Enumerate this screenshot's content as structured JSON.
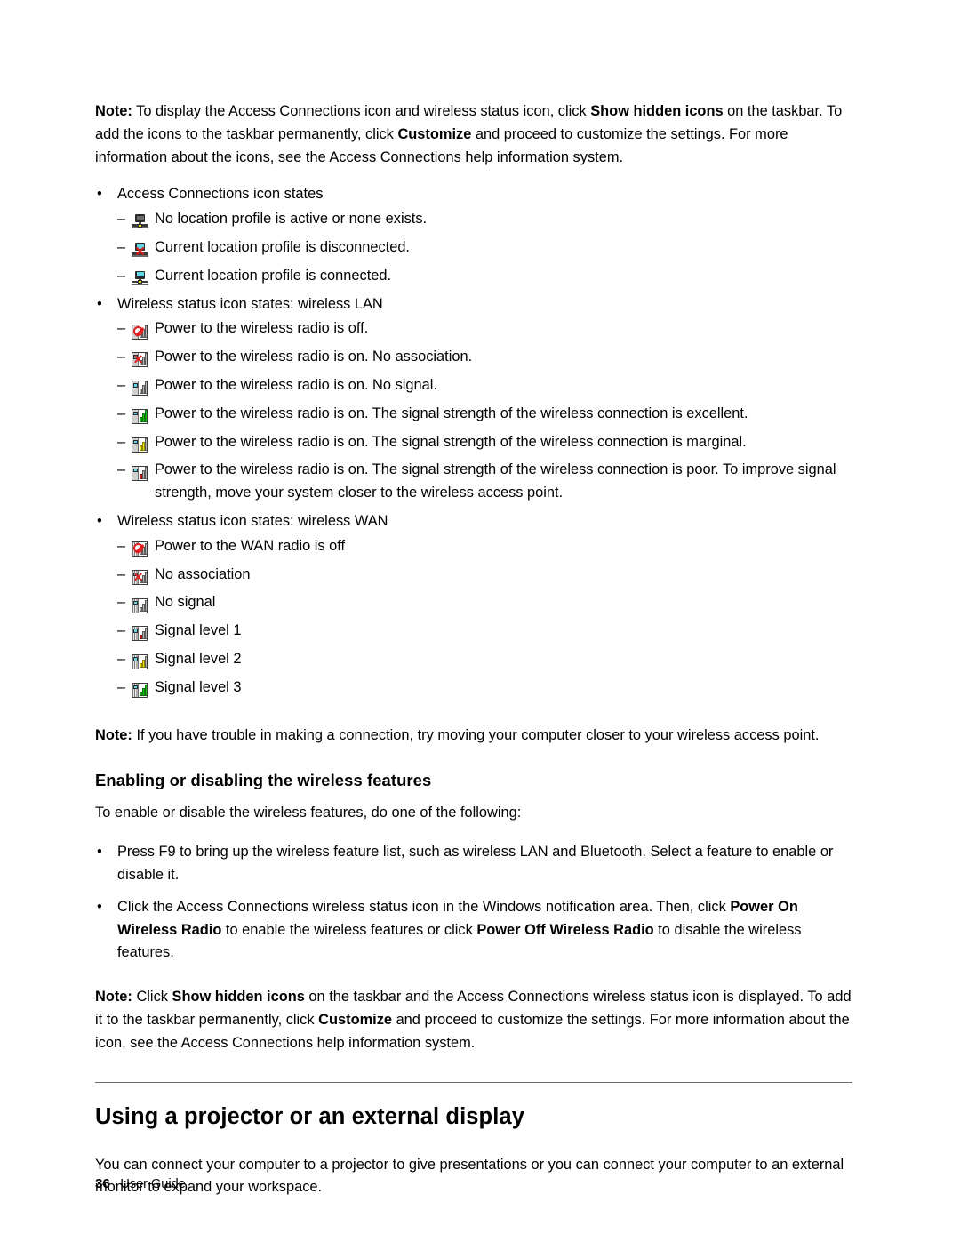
{
  "note_top": {
    "label": "Note:",
    "text_1": " To display the Access Connections icon and wireless status icon, click ",
    "bold_1": "Show hidden icons",
    "text_2": " on the taskbar. To add the icons to the taskbar permanently, click ",
    "bold_2": "Customize",
    "text_3": " and proceed to customize the settings. For more information about the icons, see the Access Connections help information system."
  },
  "access_connections": {
    "heading": "Access Connections icon states",
    "items": [
      {
        "icon": "computer-inactive-icon",
        "text": "No location profile is active or none exists."
      },
      {
        "icon": "computer-disconnected-icon",
        "text": "Current location profile is disconnected."
      },
      {
        "icon": "computer-connected-icon",
        "text": "Current location profile is connected."
      }
    ]
  },
  "wireless_lan": {
    "heading": "Wireless status icon states:  wireless LAN",
    "items": [
      {
        "icon": "wlan-radio-off-icon",
        "text": "Power to the wireless radio is off."
      },
      {
        "icon": "wlan-no-association-icon",
        "text": "Power to the wireless radio is on.  No association."
      },
      {
        "icon": "wlan-no-signal-icon",
        "text": "Power to the wireless radio is on.  No signal."
      },
      {
        "icon": "wlan-signal-excellent-icon",
        "text": "Power to the wireless radio is on. The signal strength of the wireless connection is excellent."
      },
      {
        "icon": "wlan-signal-marginal-icon",
        "text": "Power to the wireless radio is on. The signal strength of the wireless connection is marginal."
      },
      {
        "icon": "wlan-signal-poor-icon",
        "text": "Power to the wireless radio is on. The signal strength of the wireless connection is poor. To improve signal strength, move your system closer to the wireless access point."
      }
    ]
  },
  "wireless_wan": {
    "heading": "Wireless status icon states:  wireless WAN",
    "items": [
      {
        "icon": "wwan-radio-off-icon",
        "text": "Power to the WAN radio is off"
      },
      {
        "icon": "wwan-no-association-icon",
        "text": "No association"
      },
      {
        "icon": "wwan-no-signal-icon",
        "text": "No signal"
      },
      {
        "icon": "wwan-signal-level-1-icon",
        "text": "Signal level 1"
      },
      {
        "icon": "wwan-signal-level-2-icon",
        "text": "Signal level 2"
      },
      {
        "icon": "wwan-signal-level-3-icon",
        "text": "Signal level 3"
      }
    ]
  },
  "note_connection": {
    "label": "Note:",
    "text_1": " If you have trouble in making a connection, try moving your computer closer to your wireless access point."
  },
  "enabling_section": {
    "heading": "Enabling or disabling the wireless features",
    "intro": "To enable or disable the wireless features, do one of the following:",
    "bullet_1": "Press F9 to bring up the wireless feature list, such as wireless LAN and Bluetooth.  Select a feature to enable or disable it.",
    "bullet_2": {
      "text_1": "Click the Access Connections wireless status icon in the Windows notification area. Then, click ",
      "bold_1": "Power On Wireless Radio",
      "text_2": " to enable the wireless features or click ",
      "bold_2": "Power Off Wireless Radio",
      "text_3": " to disable the wireless features."
    }
  },
  "note_bottom": {
    "label": "Note:",
    "text_1": " Click ",
    "bold_1": "Show hidden icons",
    "text_2": " on the taskbar and the Access Connections wireless status icon is displayed. To add it to the taskbar permanently, click ",
    "bold_2": "Customize",
    "text_3": " and proceed to customize the settings. For more information about the icon, see the Access Connections help information system."
  },
  "projector_section": {
    "heading": "Using a projector or an external display",
    "paragraph": "You can connect your computer to a projector to give presentations or you can connect your computer to an external monitor to expand your workspace."
  },
  "footer": {
    "page_number": "36",
    "doc_title": "User Guide"
  },
  "glyphs": {
    "bullet": "•",
    "dash": "–"
  }
}
